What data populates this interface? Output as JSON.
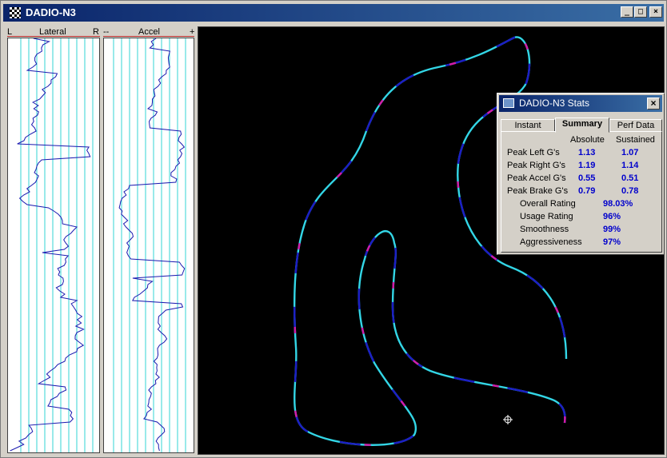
{
  "window": {
    "title": "DADIO-N3",
    "icon": "checkered-flag-icon",
    "buttons": {
      "minimize": "_",
      "maximize": "□",
      "close": "×"
    }
  },
  "lateral_chart": {
    "header_left": "L",
    "header_title": "Lateral",
    "header_right": "R"
  },
  "accel_chart": {
    "header_left": "--",
    "header_title": "Accel",
    "header_right": "+"
  },
  "colors": {
    "track_primary": "#33d6e6",
    "track_secondary": "#1c1cc4",
    "track_accent": "#d41aa8",
    "chart_trace": "#1a1ab0",
    "chart_grid": "#33d6d6"
  },
  "stats": {
    "title": "DADIO-N3 Stats",
    "close_label": "×",
    "tabs": [
      {
        "label": "Instant"
      },
      {
        "label": "Summary"
      },
      {
        "label": "Perf Data"
      }
    ],
    "columns": {
      "absolute": "Absolute",
      "sustained": "Sustained"
    },
    "rows": [
      {
        "label": "Peak Left G's",
        "absolute": "1.13",
        "sustained": "1.07"
      },
      {
        "label": "Peak Right G's",
        "absolute": "1.19",
        "sustained": "1.14"
      },
      {
        "label": "Peak Accel G's",
        "absolute": "0.55",
        "sustained": "0.51"
      },
      {
        "label": "Peak Brake G's",
        "absolute": "0.79",
        "sustained": "0.78"
      }
    ],
    "ratings": [
      {
        "label": "Overall Rating",
        "value": "98.03%"
      },
      {
        "label": "Usage Rating",
        "value": "96%"
      },
      {
        "label": "Smoothness",
        "value": "99%"
      },
      {
        "label": "Aggressiveness",
        "value": "97%"
      }
    ]
  }
}
